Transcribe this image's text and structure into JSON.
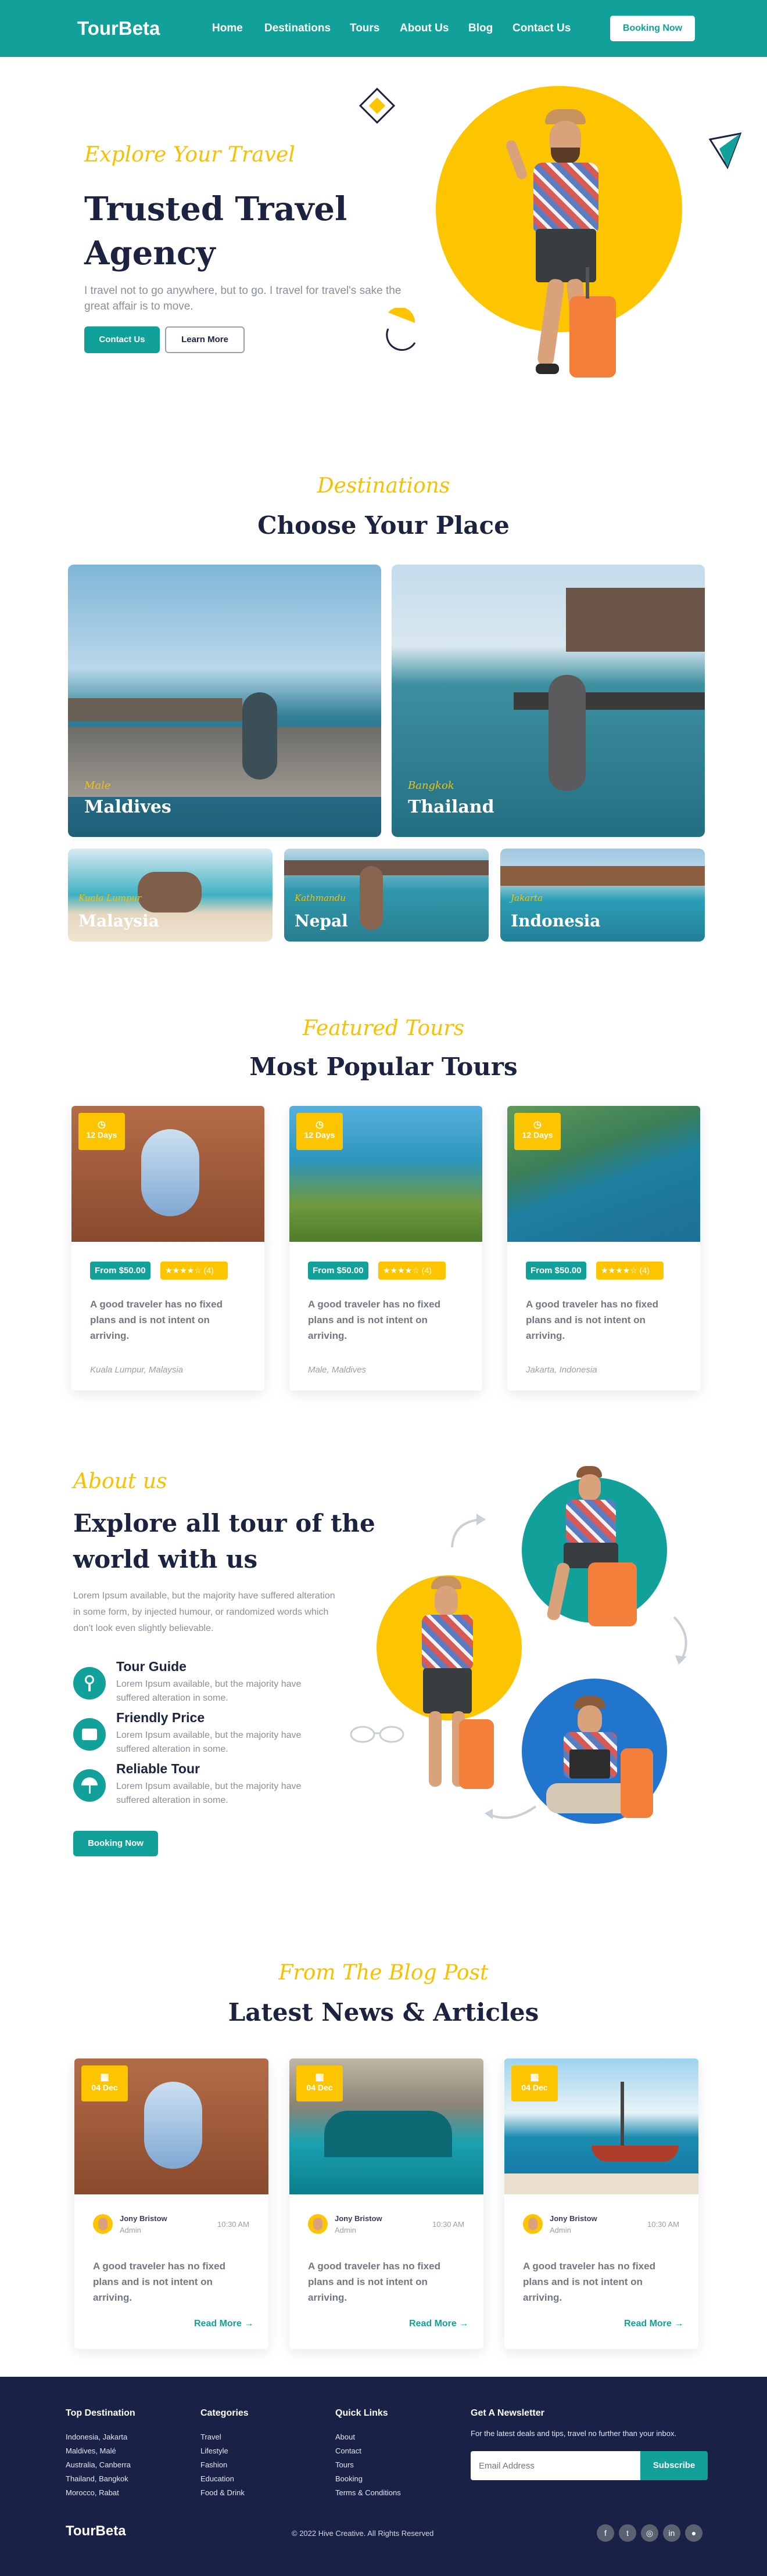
{
  "header": {
    "logo": "TourBeta",
    "nav": [
      "Home",
      "Destinations",
      "Tours",
      "About Us",
      "Blog",
      "Contact Us"
    ],
    "cta": "Booking Now"
  },
  "hero": {
    "script": "Explore Your Travel",
    "title_line1": "Trusted Travel",
    "title_line2": "Agency",
    "text": "I travel not to go anywhere, but to go. I travel for travel's sake the great affair is to move.",
    "btn_primary": "Contact Us",
    "btn_secondary": "Learn More"
  },
  "destinations": {
    "script": "Destinations",
    "title": "Choose Your Place",
    "items": [
      {
        "sub": "Male",
        "name": "Maldives"
      },
      {
        "sub": "Bangkok",
        "name": "Thailand"
      },
      {
        "sub": "Kuala Lumpur",
        "name": "Malaysia"
      },
      {
        "sub": "Kathmandu",
        "name": "Nepal"
      },
      {
        "sub": "Jakarta",
        "name": "Indonesia"
      }
    ]
  },
  "tours": {
    "script": "Featured Tours",
    "title": "Most Popular Tours",
    "items": [
      {
        "days": "12 Days",
        "price": "From $50.00",
        "rating": "(4)",
        "text": "A good traveler has no fixed plans and is not intent on arriving.",
        "location": "Kuala Lumpur, Malaysia"
      },
      {
        "days": "12 Days",
        "price": "From $50.00",
        "rating": "(4)",
        "text": "A good traveler has no fixed plans and is not intent on arriving.",
        "location": "Male, Maldives"
      },
      {
        "days": "12 Days",
        "price": "From $50.00",
        "rating": "(4)",
        "text": "A good traveler has no fixed plans and is not intent on arriving.",
        "location": "Jakarta, Indonesia"
      }
    ]
  },
  "about": {
    "script": "About us",
    "title_line1": "Explore all tour of the",
    "title_line2": "world with us",
    "text": "Lorem Ipsum available, but the majority have suffered alteration in some form, by injected humour, or randomized words which don't look even slightly believable.",
    "features": [
      {
        "title": "Tour Guide",
        "desc": "Lorem Ipsum available, but the majority have suffered alteration in some."
      },
      {
        "title": "Friendly Price",
        "desc": "Lorem Ipsum available, but the majority have suffered alteration in some."
      },
      {
        "title": "Reliable Tour",
        "desc": "Lorem Ipsum available, but the majority have suffered alteration in some."
      }
    ],
    "cta": "Booking Now"
  },
  "blog": {
    "script": "From The Blog Post",
    "title": "Latest News & Articles",
    "items": [
      {
        "date": "04 Dec",
        "author": "Jony Bristow",
        "role": "Admin",
        "time": "10:30 AM",
        "text": "A good traveler has no fixed plans and is not intent on arriving.",
        "more": "Read More"
      },
      {
        "date": "04 Dec",
        "author": "Jony Bristow",
        "role": "Admin",
        "time": "10:30 AM",
        "text": "A good traveler has no fixed plans and is not intent on arriving.",
        "more": "Read More"
      },
      {
        "date": "04 Dec",
        "author": "Jony Bristow",
        "role": "Admin",
        "time": "10:30 AM",
        "text": "A good traveler has no fixed plans and is not intent on arriving.",
        "more": "Read More"
      }
    ]
  },
  "footer": {
    "col1_title": "Top Destination",
    "col1": [
      "Indonesia, Jakarta",
      "Maldives, Malé",
      "Australia, Canberra",
      "Thailand, Bangkok",
      "Morocco, Rabat"
    ],
    "col2_title": "Categories",
    "col2": [
      "Travel",
      "Lifestyle",
      "Fashion",
      "Education",
      "Food & Drink"
    ],
    "col3_title": "Quick Links",
    "col3": [
      "About",
      "Contact",
      "Tours",
      "Booking",
      "Terms & Conditions"
    ],
    "newsletter_title": "Get A Newsletter",
    "newsletter_text": "For the latest deals and tips, travel no further than your inbox.",
    "email_placeholder": "Email Address",
    "subscribe": "Subscribe",
    "logo": "TourBeta",
    "copyright": "© 2022 Hive Creative. All Rights Reserved",
    "socials": [
      "facebook-icon",
      "twitter-icon",
      "instagram-icon",
      "linkedin-icon",
      "github-icon"
    ]
  },
  "colors": {
    "teal": "#12a19a",
    "yellow": "#fcc500",
    "navy": "#192146"
  }
}
